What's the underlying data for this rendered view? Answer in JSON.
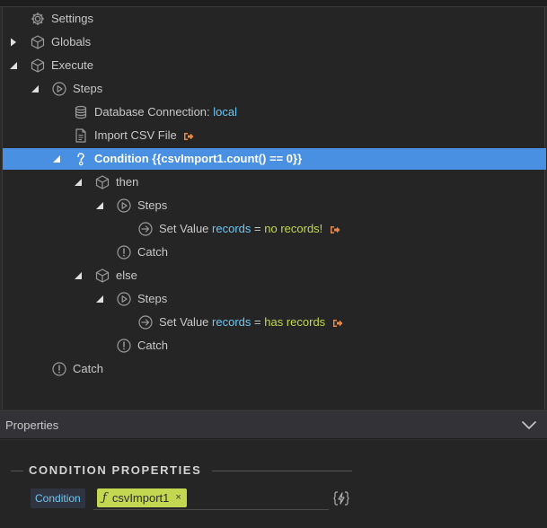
{
  "tree": {
    "rows": [
      {
        "label": "Settings",
        "icon": "gear-icon"
      },
      {
        "label": "Globals",
        "icon": "cube-icon"
      },
      {
        "label": "Execute",
        "icon": "cube-icon"
      },
      {
        "label": "Steps",
        "icon": "play-circle-icon"
      },
      {
        "label": "Database Connection:",
        "value": "local",
        "icon": "database-icon"
      },
      {
        "label": "Import CSV File",
        "icon": "file-icon"
      },
      {
        "label": "Condition {{csvImport1.count() == 0}}",
        "icon": "question-icon"
      },
      {
        "label": "then",
        "icon": "cube-icon"
      },
      {
        "label": "Steps",
        "icon": "play-circle-icon"
      },
      {
        "label": "Set Value",
        "prop": "records",
        "eq": "=",
        "value": "no records!",
        "icon": "arrow-circle-icon"
      },
      {
        "label": "Catch",
        "icon": "exclamation-circle-icon"
      },
      {
        "label": "else",
        "icon": "cube-icon"
      },
      {
        "label": "Steps",
        "icon": "play-circle-icon"
      },
      {
        "label": "Set Value",
        "prop": "records",
        "eq": "=",
        "value": "has records",
        "icon": "arrow-circle-icon"
      },
      {
        "label": "Catch",
        "icon": "exclamation-circle-icon"
      },
      {
        "label": "Catch",
        "icon": "exclamation-circle-icon"
      }
    ]
  },
  "properties": {
    "header_title": "Properties",
    "section_title": "CONDITION PROPERTIES",
    "field_label": "Condition",
    "chip_fx": "ƒ",
    "chip_value": "csvImport1",
    "chip_remove": "×"
  },
  "colors": {
    "selected_bg": "#4a90e2",
    "prop_color": "#6ec7f2",
    "value_color": "#c3d850",
    "link_color": "#e8894a"
  }
}
